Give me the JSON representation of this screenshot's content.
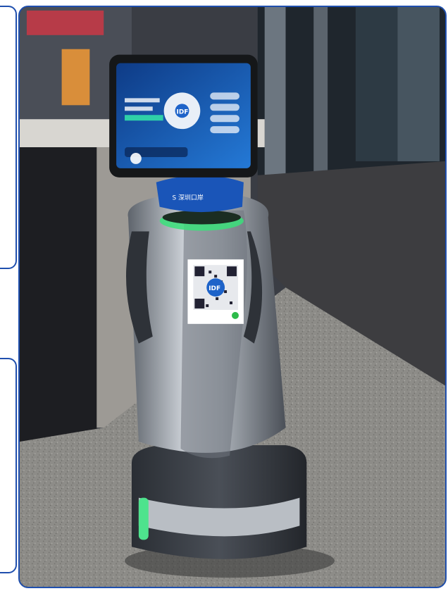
{
  "photo": {
    "description_label": "",
    "robot": {
      "base_logo_text": "S 深圳口岸",
      "qr_label": "IDF",
      "screen_qr_label": "IDF"
    }
  },
  "colors": {
    "frame": "#1f4fae",
    "robot_body": "#9aa1aa",
    "robot_dark": "#3a3f46",
    "screen_blue": "#1d66c8",
    "accent_green": "#39e07a",
    "floor_granite": "#8a8a86",
    "carpet": "#3a3a3c"
  }
}
